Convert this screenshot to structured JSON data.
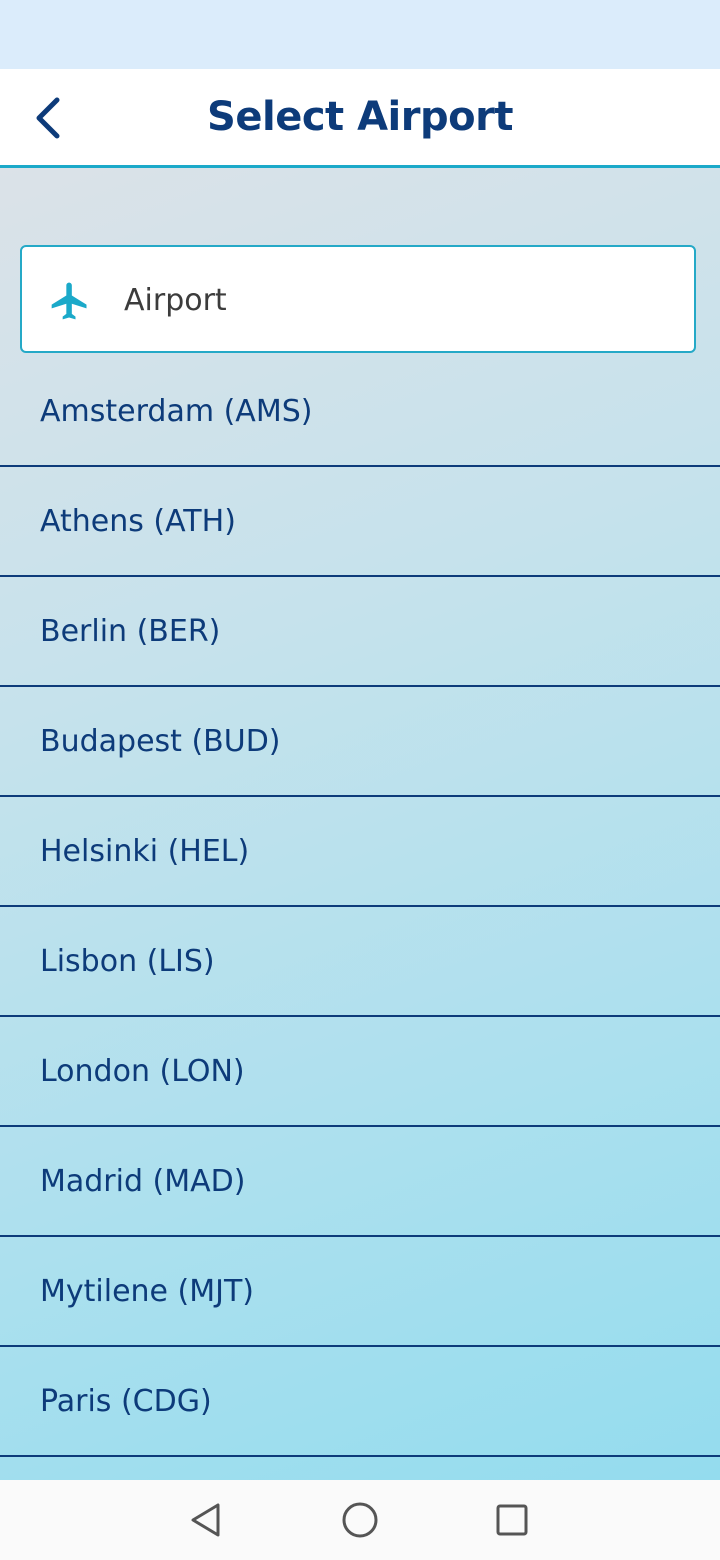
{
  "header": {
    "title": "Select Airport",
    "back_icon": "chevron-left-icon"
  },
  "search": {
    "placeholder": "Airport",
    "value": "",
    "icon": "airplane-icon"
  },
  "airports": [
    {
      "label": "Amsterdam (AMS)"
    },
    {
      "label": "Athens (ATH)"
    },
    {
      "label": "Berlin (BER)"
    },
    {
      "label": "Budapest (BUD)"
    },
    {
      "label": "Helsinki (HEL)"
    },
    {
      "label": "Lisbon (LIS)"
    },
    {
      "label": "London (LON)"
    },
    {
      "label": "Madrid (MAD)"
    },
    {
      "label": "Mytilene (MJT)"
    },
    {
      "label": "Paris (CDG)"
    }
  ],
  "system_nav": {
    "back_icon": "nav-back-icon",
    "home_icon": "nav-home-icon",
    "recents_icon": "nav-recents-icon"
  },
  "colors": {
    "primary_text": "#0d3b7a",
    "accent": "#1ba9c9",
    "status_bar": "#dbecfb"
  }
}
